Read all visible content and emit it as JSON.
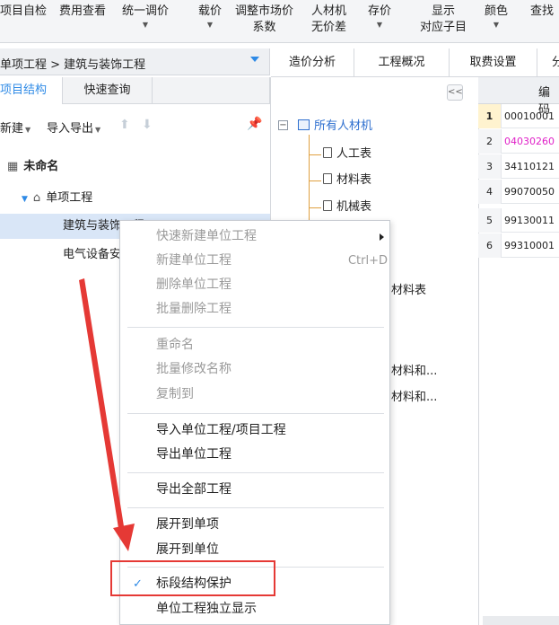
{
  "toolbar": {
    "items": [
      {
        "label": "项目自检",
        "caret": ""
      },
      {
        "label": "费用查看",
        "caret": ""
      },
      {
        "label": "统一调价",
        "caret": "▼"
      },
      {
        "label": "载价",
        "caret": "▼"
      },
      {
        "label": "调整市场价",
        "line2": "系数",
        "caret": ""
      },
      {
        "label": "人材机",
        "line2": "无价差",
        "caret": ""
      },
      {
        "label": "存价",
        "caret": "▼"
      },
      {
        "label": "显示",
        "line2": "对应子目",
        "caret": ""
      },
      {
        "label": "颜色",
        "caret": "▼"
      },
      {
        "label": "查找",
        "caret": ""
      }
    ]
  },
  "breadcrumb": "单项工程 > 建筑与装饰工程",
  "tabs": [
    "造价分析",
    "工程概况",
    "取费设置",
    "分"
  ],
  "subtabs": [
    "项目结构",
    "快速查询"
  ],
  "left_tools": {
    "new": "新建",
    "import_export": "导入导出"
  },
  "tree": {
    "root": "未命名",
    "single": "单项工程",
    "items": [
      "建筑与装饰工程",
      "电气设备安装工程"
    ]
  },
  "mid_tree": {
    "root": "所有人材机",
    "items": [
      "人工表",
      "材料表",
      "机械表"
    ],
    "partial": [
      "材料表",
      "材料和...",
      "材料和..."
    ]
  },
  "grid": {
    "header": "编码",
    "rows": [
      {
        "num": "1",
        "code": "00010001"
      },
      {
        "num": "2",
        "code": "04030260"
      },
      {
        "num": "3",
        "code": "34110121"
      },
      {
        "num": "4",
        "code": "99070050"
      },
      {
        "num": "5",
        "code": "99130011"
      },
      {
        "num": "6",
        "code": "99310001"
      }
    ]
  },
  "context_menu": {
    "items": [
      {
        "label": "快速新建单位工程",
        "disabled": true,
        "submenu": true
      },
      {
        "label": "新建单位工程",
        "disabled": true,
        "shortcut": "Ctrl+D"
      },
      {
        "label": "删除单位工程",
        "disabled": true
      },
      {
        "label": "批量删除工程",
        "disabled": true
      },
      {
        "label": "重命名",
        "disabled": true
      },
      {
        "label": "批量修改名称",
        "disabled": true
      },
      {
        "label": "复制到",
        "disabled": true
      },
      {
        "label": "导入单位工程/项目工程",
        "disabled": false
      },
      {
        "label": "导出单位工程",
        "disabled": false
      },
      {
        "label": "导出全部工程",
        "disabled": false
      },
      {
        "label": "展开到单项",
        "disabled": false
      },
      {
        "label": "展开到单位",
        "disabled": false
      },
      {
        "label": "标段结构保护",
        "disabled": false,
        "checked": true
      },
      {
        "label": "单位工程独立显示",
        "disabled": false
      }
    ]
  },
  "colors": {
    "accent": "#2e8ae6",
    "annotation": "#e53935",
    "pink_code": "#e020c8"
  }
}
